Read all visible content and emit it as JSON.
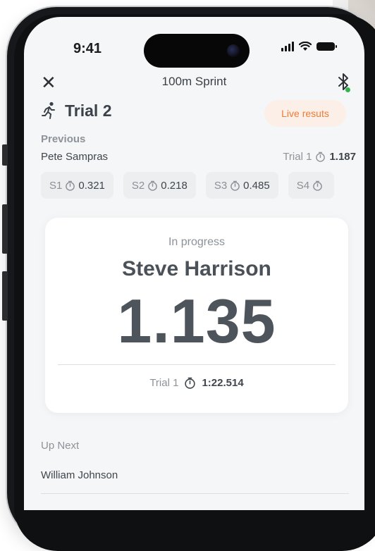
{
  "status_bar": {
    "time": "9:41"
  },
  "header": {
    "title": "100m Sprint"
  },
  "trial": {
    "title": "Trial 2",
    "live_badge": "Live resuts"
  },
  "previous": {
    "label": "Previous",
    "athlete": "Pete Sampras",
    "trial_label": "Trial 1",
    "trial_time": "1.187",
    "splits": [
      {
        "label": "S1",
        "value": "0.321"
      },
      {
        "label": "S2",
        "value": "0.218"
      },
      {
        "label": "S3",
        "value": "0.485"
      },
      {
        "label": "S4",
        "value": ""
      }
    ]
  },
  "current": {
    "status": "In progress",
    "athlete": "Steve Harrison",
    "time": "1.135",
    "trial_label": "Trial 1",
    "trial_time": "1:22.514"
  },
  "up_next": {
    "label": "Up Next",
    "athlete": "William Johnson"
  },
  "colors": {
    "accent_orange": "#f07b34",
    "badge_bg": "#fcefe7",
    "connected_green": "#2eb84b"
  }
}
